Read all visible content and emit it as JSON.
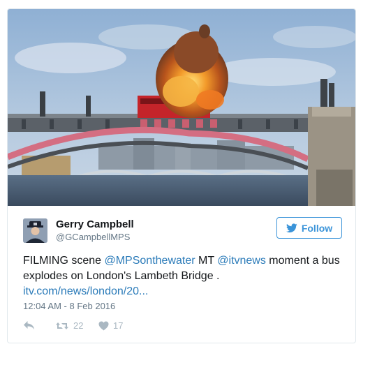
{
  "tweet": {
    "author_name": "Gerry Campbell",
    "author_handle": "@GCampbellMPS",
    "follow_label": "Follow",
    "text_prefix": "FILMING scene ",
    "mention_1": "@MPSonthewater",
    "text_mid": " MT ",
    "mention_2": "@itvnews",
    "text_suffix": " moment a bus explodes on London's Lambeth Bridge .",
    "link": "itv.com/news/london/20...",
    "timestamp": "12:04 AM - 8 Feb 2016",
    "retweet_count": "22",
    "like_count": "17"
  },
  "icons": {
    "reply": "reply-icon",
    "retweet": "retweet-icon",
    "like": "heart-icon",
    "follow": "twitter-bird-icon"
  },
  "colors": {
    "accent": "#3b94d9",
    "link": "#2b7bb9",
    "muted": "#657786",
    "action": "#aab8c2"
  }
}
